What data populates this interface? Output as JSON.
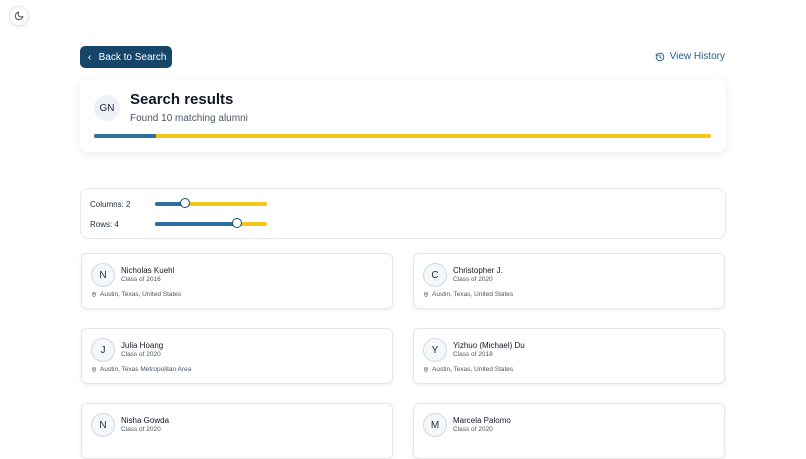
{
  "header": {
    "back_label": "Back to Search",
    "history_label": "View History"
  },
  "summary": {
    "avatar_initials": "GN",
    "title": "Search results",
    "subtitle": "Found 10 matching alumni",
    "progress_fraction": 0.1
  },
  "controls": {
    "columns_label": "Columns: 2",
    "columns_fraction": 0.27,
    "rows_label": "Rows: 4",
    "rows_fraction": 0.73
  },
  "results": [
    {
      "initial": "N",
      "name": "Nicholas Kuehl",
      "class": "Class of 2016",
      "location": "Austin, Texas, United States"
    },
    {
      "initial": "C",
      "name": "Christopher J.",
      "class": "Class of 2020",
      "location": "Austin, Texas, United States"
    },
    {
      "initial": "J",
      "name": "Julia Hoang",
      "class": "Class of 2020",
      "location": "Austin, Texas Metropolitan Area"
    },
    {
      "initial": "Y",
      "name": "Yizhuo (Michael) Du",
      "class": "Class of 2018",
      "location": "Austin, Texas, United States"
    },
    {
      "initial": "N",
      "name": "Nisha Gowda",
      "class": "Class of 2020",
      "location": ""
    },
    {
      "initial": "M",
      "name": "Marcela Palomo",
      "class": "Class of 2020",
      "location": ""
    }
  ],
  "colors": {
    "primary": "#16476a",
    "accent": "#f5c518",
    "fill": "#2e6f9e"
  }
}
